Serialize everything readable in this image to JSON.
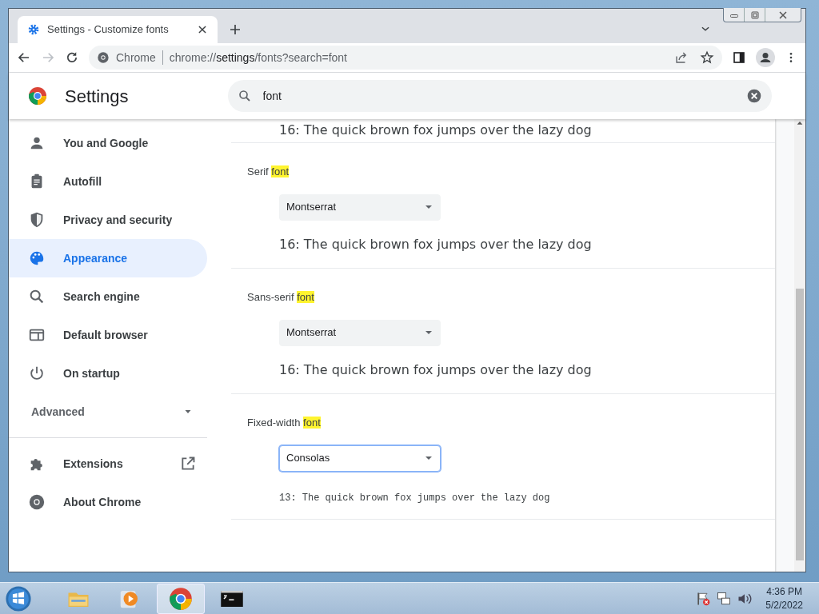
{
  "tab": {
    "title": "Settings - Customize fonts",
    "selected": true
  },
  "address": {
    "origin": "Chrome",
    "scheme": "chrome://",
    "host": "settings",
    "path": "/fonts?search=font"
  },
  "header": {
    "title": "Settings"
  },
  "search": {
    "value": "font"
  },
  "sidebar": {
    "items": [
      {
        "label": "You and Google",
        "kind": "person",
        "selected": false
      },
      {
        "label": "Autofill",
        "kind": "clipboard",
        "selected": false
      },
      {
        "label": "Privacy and security",
        "kind": "shield",
        "selected": false
      },
      {
        "label": "Appearance",
        "kind": "palette",
        "selected": true
      },
      {
        "label": "Search engine",
        "kind": "search",
        "selected": false
      },
      {
        "label": "Default browser",
        "kind": "browser",
        "selected": false
      },
      {
        "label": "On startup",
        "kind": "power",
        "selected": false
      }
    ],
    "advanced": {
      "label": "Advanced",
      "expanded": false
    },
    "extra": [
      {
        "label": "Extensions",
        "kind": "puzzle",
        "external": true
      },
      {
        "label": "About Chrome",
        "kind": "chrome",
        "external": false
      }
    ]
  },
  "sections": [
    {
      "kind": "partial",
      "preview": "16: The quick brown fox jumps over the lazy dog"
    },
    {
      "kind": "serif",
      "label": "Serif",
      "match": "font",
      "select": {
        "value": "Montserrat",
        "focused": false
      },
      "preview": "16: The quick brown fox jumps over the lazy dog"
    },
    {
      "kind": "sans",
      "label": "Sans-serif",
      "match": "font",
      "select": {
        "value": "Montserrat",
        "focused": false
      },
      "preview": "16: The quick brown fox jumps over the lazy dog"
    },
    {
      "kind": "mono",
      "label": "Fixed-width",
      "match": "font",
      "select": {
        "value": "Consolas",
        "focused": true
      },
      "preview": "13: The quick brown fox jumps over the lazy dog"
    }
  ],
  "taskbar": {
    "apps": [
      {
        "kind": "folder",
        "selected": false
      },
      {
        "kind": "media",
        "selected": false
      },
      {
        "kind": "chrome",
        "selected": true
      },
      {
        "kind": "console",
        "selected": false
      }
    ],
    "clock": {
      "time": "4:36 PM",
      "date": "5/2/2022"
    }
  }
}
